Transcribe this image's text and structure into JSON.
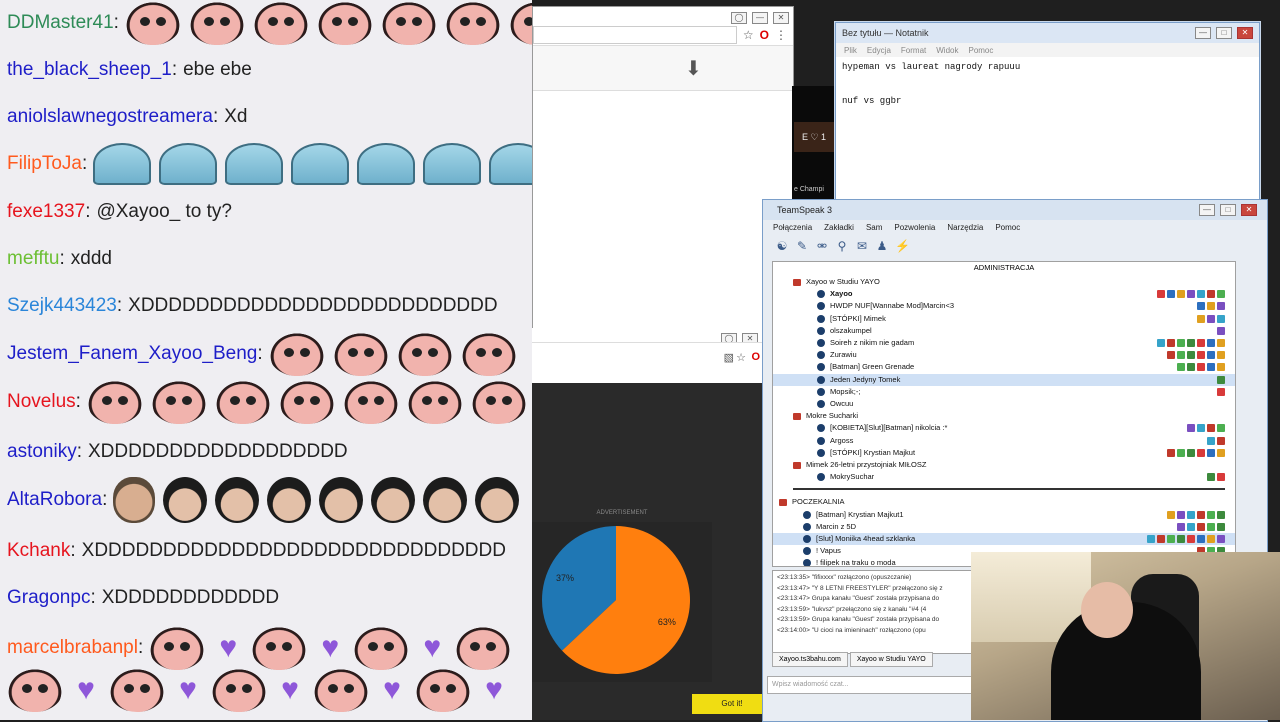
{
  "chat": {
    "messages": [
      {
        "user": "DDMaster41",
        "color": "#2e8b57",
        "text": "",
        "emotes": [
          "cry",
          "cry",
          "cry",
          "cry",
          "cry",
          "cry",
          "cry"
        ]
      },
      {
        "user": "the_black_sheep_1",
        "color": "#1e1ec8",
        "text": "ebe ebe",
        "emotes": []
      },
      {
        "user": "aniolslawnegostreamera",
        "color": "#1e1ec8",
        "text": "Xd",
        "emotes": []
      },
      {
        "user": "FilipToJa",
        "color": "#ff5a1e",
        "text": "",
        "emotes": [
          "tent",
          "tent",
          "tent",
          "tent",
          "tent",
          "tent",
          "tent"
        ]
      },
      {
        "user": "fexe1337",
        "color": "#e6141e",
        "text": "@Xayoo_ to ty?",
        "emotes": []
      },
      {
        "user": "mefftu",
        "color": "#6cbf33",
        "text": "xddd",
        "emotes": []
      },
      {
        "user": "Szejk443423",
        "color": "#2a85d9",
        "text": "XDDDDDDDDDDDDDDDDDDDDDDDDDD",
        "emotes": []
      },
      {
        "user": "Jestem_Fanem_Xayoo_Beng",
        "color": "#1e1ec8",
        "text": "",
        "emotes": [
          "cry",
          "cry",
          "cry",
          "cry"
        ]
      },
      {
        "user": "Novelus",
        "color": "#e6141e",
        "text": "",
        "emotes": [
          "cry",
          "cry",
          "cry",
          "cry",
          "cry",
          "cry",
          "cry"
        ]
      },
      {
        "user": "astoniky",
        "color": "#1e1ec8",
        "text": "XDDDDDDDDDDDDDDDDDD",
        "emotes": []
      },
      {
        "user": "AltaRobora",
        "color": "#1e1ec8",
        "text": "",
        "emotes": [
          "face2",
          "face",
          "face",
          "face",
          "face",
          "face",
          "face",
          "face"
        ]
      },
      {
        "user": "Kchank",
        "color": "#e6141e",
        "text": "XDDDDDDDDDDDDDDDDDDDDDDDDDDDDDD",
        "emotes": []
      },
      {
        "user": "Gragonpc",
        "color": "#1e1ec8",
        "text": "XDDDDDDDDDDDD",
        "emotes": []
      },
      {
        "user": "marcelbrabanpl",
        "color": "#ff5a1e",
        "text": "",
        "emotes": [
          "cry",
          "heart",
          "cry",
          "heart",
          "cry",
          "heart",
          "cry"
        ]
      },
      {
        "user": "",
        "color": "#222",
        "text": "",
        "emotes": [
          "cry",
          "heart",
          "cry",
          "heart",
          "cry",
          "heart",
          "cry",
          "heart",
          "cry",
          "heart"
        ]
      }
    ]
  },
  "browser": {
    "pie": {
      "advert_label": "ADVERTISEMENT",
      "slices": [
        {
          "label": "37%",
          "value": 37,
          "color": "#1f77b4"
        },
        {
          "label": "63%",
          "value": 63,
          "color": "#ff7f0e"
        }
      ],
      "got_it": "Got it!"
    }
  },
  "notepad": {
    "title": "Bez tytułu — Notatnik",
    "menu": [
      "Plik",
      "Edycja",
      "Format",
      "Widok",
      "Pomoc"
    ],
    "lines": [
      "hypeman vs laureat nagrody rapuuu",
      "",
      "nuf vs ggbr"
    ]
  },
  "teamspeak": {
    "title": "TeamSpeak 3",
    "menu": [
      "Połączenia",
      "Zakładki",
      "Sam",
      "Pozwolenia",
      "Narzędzia",
      "Pomoc"
    ],
    "header": "ADMINISTRACJA",
    "rows": [
      {
        "type": "channel",
        "indent": 20,
        "text": "Xayoo w Studiu YAYO"
      },
      {
        "type": "user",
        "indent": 44,
        "text": "Xayoo",
        "bold": true,
        "badges": 7
      },
      {
        "type": "user",
        "indent": 44,
        "text": "HWDP NUF[Wannabe Mod]Marcin<3",
        "badges": 3
      },
      {
        "type": "user",
        "indent": 44,
        "text": "[STÓPKI] Mimek",
        "badges": 3
      },
      {
        "type": "user",
        "indent": 44,
        "text": "olszakumpel",
        "badges": 1
      },
      {
        "type": "user",
        "indent": 44,
        "text": "Soireh z nikim nie gadam",
        "badges": 7
      },
      {
        "type": "user",
        "indent": 44,
        "text": "Zurawiu",
        "badges": 6
      },
      {
        "type": "user",
        "indent": 44,
        "text": "[Batman] Green Grenade",
        "badges": 5
      },
      {
        "type": "user",
        "indent": 44,
        "text": "Jeden Jedyny Tomek",
        "selected": true,
        "badges": 1
      },
      {
        "type": "user",
        "indent": 44,
        "text": "Mopsik;-;",
        "badges": 1
      },
      {
        "type": "user",
        "indent": 44,
        "text": "Owcuu",
        "badges": 0
      },
      {
        "type": "channel",
        "indent": 20,
        "text": "Mokre Sucharki"
      },
      {
        "type": "user",
        "indent": 44,
        "text": "[KOBIETA][Slut][Batman] nikolcia :*",
        "badges": 4
      },
      {
        "type": "user",
        "indent": 44,
        "text": "Argoss",
        "badges": 2
      },
      {
        "type": "user",
        "indent": 44,
        "text": "[STÓPKI] Krystian Majkut",
        "badges": 6
      },
      {
        "type": "channel",
        "indent": 20,
        "text": "Mimek 26-letni przystojniak MIŁOSZ"
      },
      {
        "type": "user",
        "indent": 44,
        "text": "MokrySuchar",
        "badges": 2
      },
      {
        "type": "spacer",
        "indent": 0,
        "text": ""
      },
      {
        "type": "channel",
        "indent": 6,
        "text": "POCZEKALNIA"
      },
      {
        "type": "user",
        "indent": 30,
        "text": "[Batman] Krystian Majkut1",
        "badges": 6
      },
      {
        "type": "user",
        "indent": 30,
        "text": "Marcin z 5D",
        "badges": 5
      },
      {
        "type": "user",
        "indent": 30,
        "text": "[Slut] Moniika 4head szklanka",
        "selected": true,
        "badges": 8
      },
      {
        "type": "user",
        "indent": 30,
        "text": "!     Vapus",
        "badges": 3
      },
      {
        "type": "user",
        "indent": 30,
        "text": "! filipek na traku o moda",
        "badges": 0
      }
    ],
    "log": [
      "<23:13:35> \"fifixxxx\" rozłączono (opuszczanie)",
      "<23:13:47> \"Y 8 LETNI FREESTYLER\" przełączono się z",
      "<23:13:47> Grupa kanału \"Guest\" została przypisana do",
      "<23:13:59> \"lukvsz\" przełączono się z kanału \"#4 (4",
      "<23:13:59> Grupa kanału \"Guest\" została przypisana do",
      "<23:14:00> \"U cioci na imieninach\" rozłączono (opu"
    ],
    "tabs": [
      "Xayoo.ts3bahu.com",
      "Xayoo w Studiu YAYO"
    ],
    "input_placeholder": "Wpisz wiadomość czat..."
  }
}
